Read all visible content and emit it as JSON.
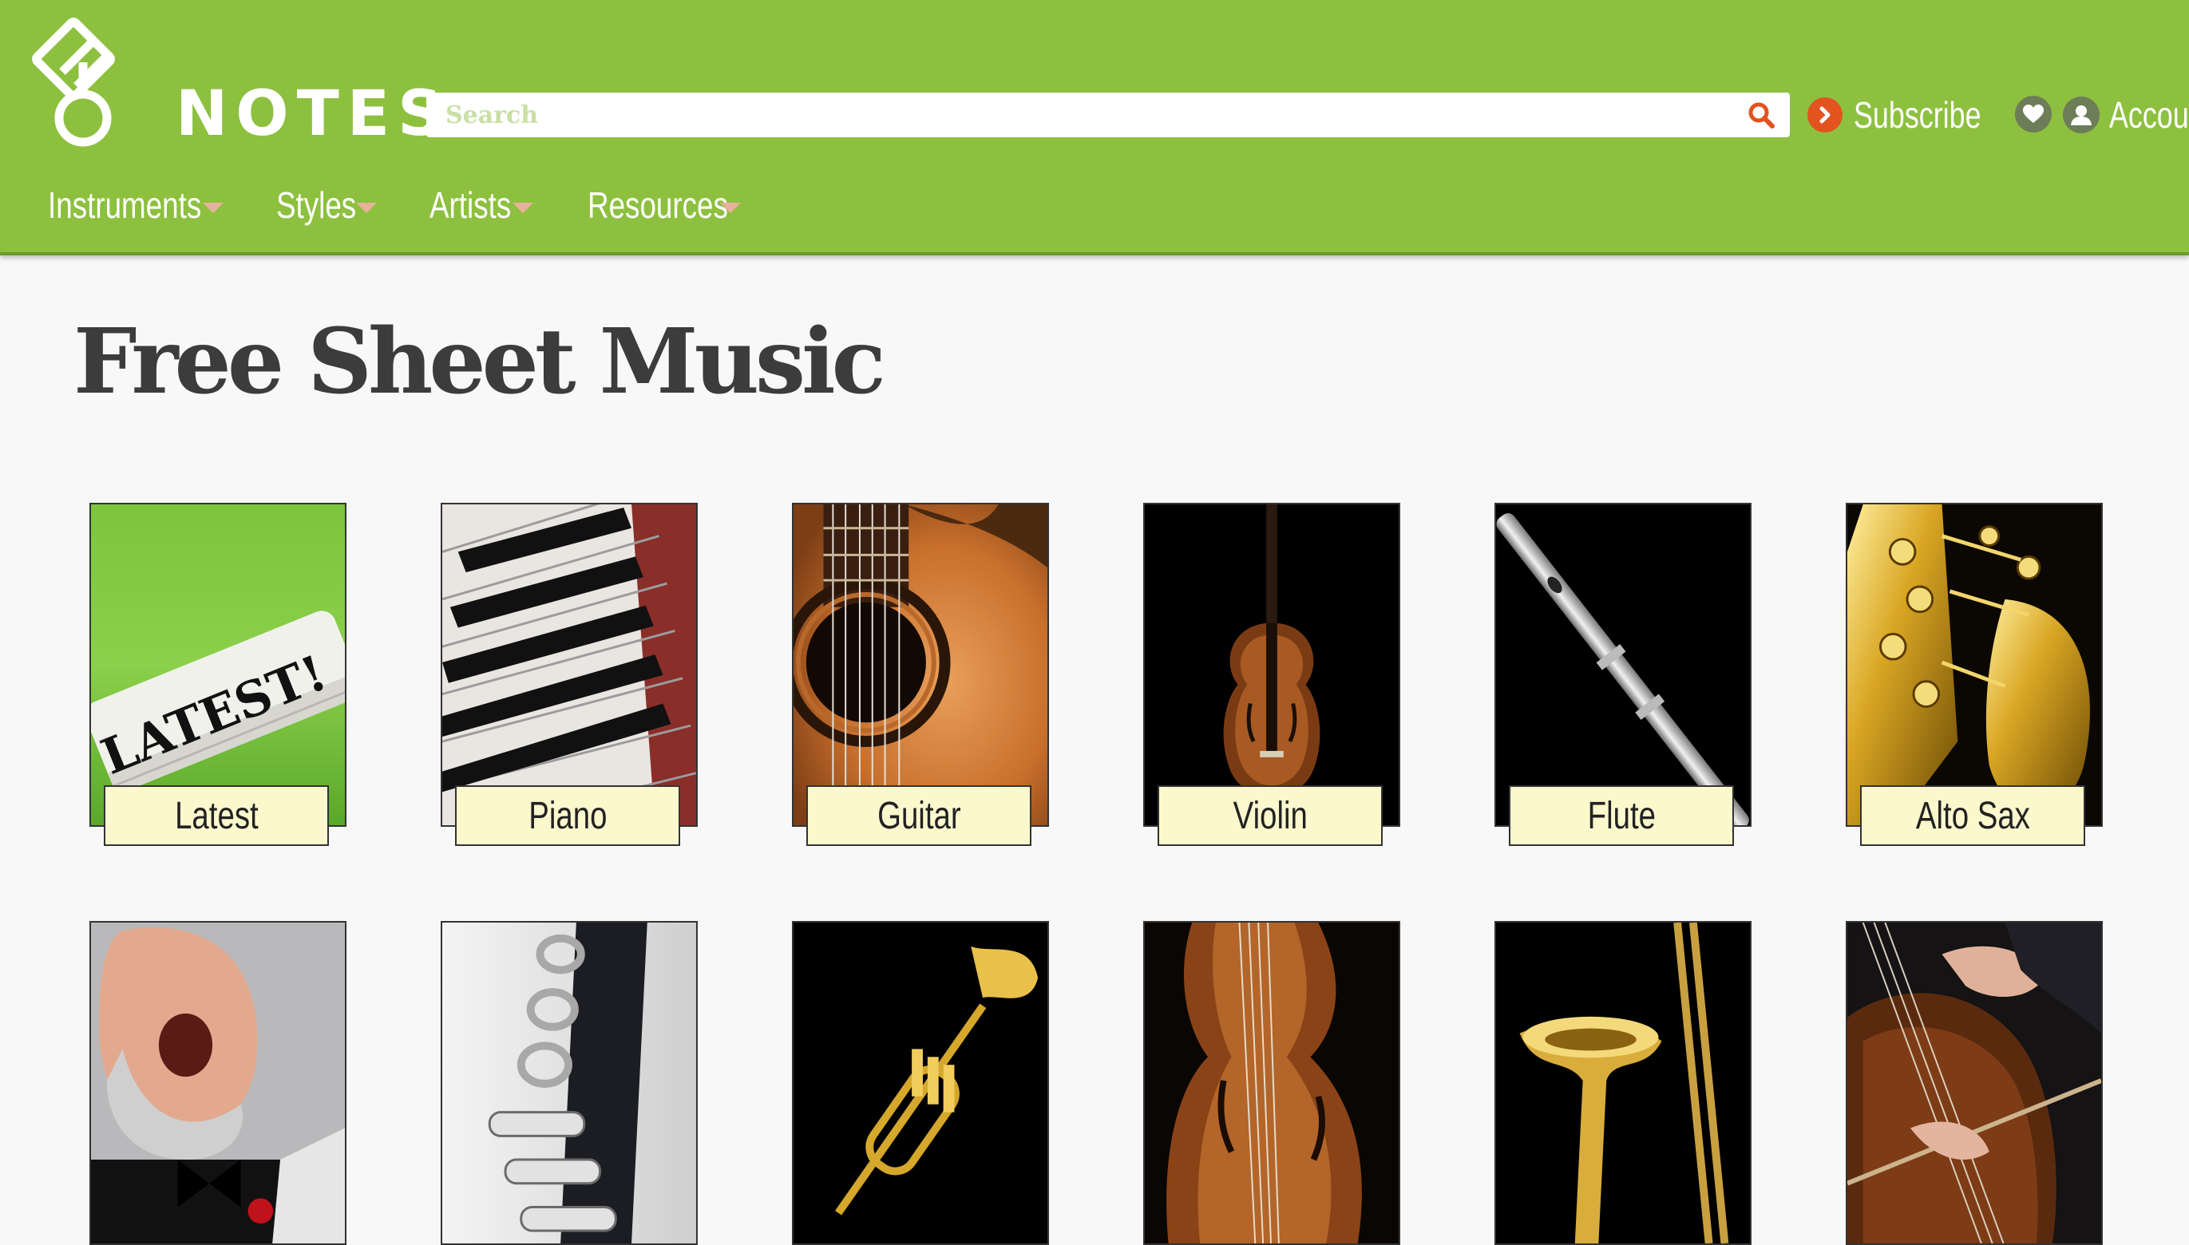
{
  "header": {
    "logo_text": "NOTES",
    "search_placeholder": "Search",
    "subscribe_label": "Subscribe",
    "account_label": "Account"
  },
  "nav": {
    "items": [
      {
        "label": "Instruments"
      },
      {
        "label": "Styles"
      },
      {
        "label": "Artists"
      },
      {
        "label": "Resources"
      }
    ]
  },
  "main": {
    "title": "Free Sheet Music",
    "row1": [
      {
        "label": "Latest",
        "image_text": "LATEST!"
      },
      {
        "label": "Piano"
      },
      {
        "label": "Guitar"
      },
      {
        "label": "Violin"
      },
      {
        "label": "Flute"
      },
      {
        "label": "Alto Sax"
      }
    ]
  },
  "colors": {
    "header_bg": "#8dc03f",
    "subscribe_accent": "#e2531f",
    "label_bg": "#fbf8cd",
    "page_bg": "#f8f8f8"
  },
  "icons": [
    "8notes-logo",
    "search-icon",
    "chevron-right-icon",
    "heart-icon",
    "user-icon",
    "caret-down-icon"
  ]
}
